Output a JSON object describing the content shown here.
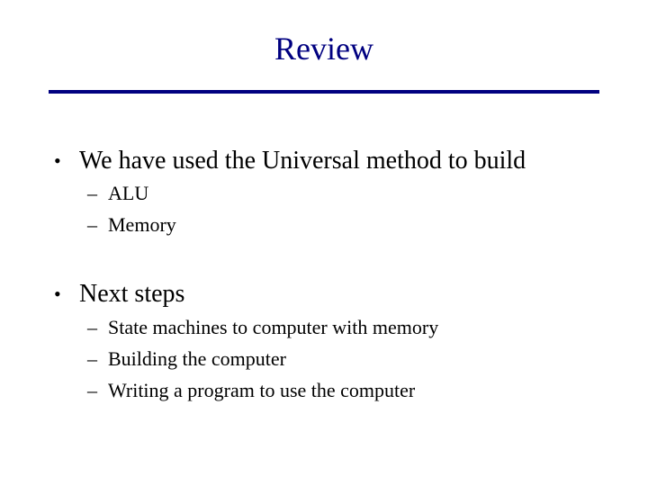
{
  "slide": {
    "title": "Review",
    "title_color": "#000080",
    "bullets": [
      {
        "marker": "•",
        "text": "We have used the Universal method to build",
        "subitems": [
          {
            "marker": "–",
            "text": "ALU"
          },
          {
            "marker": "–",
            "text": "Memory"
          }
        ]
      },
      {
        "marker": "•",
        "text": "Next steps",
        "subitems": [
          {
            "marker": "–",
            "text": "State machines to computer with memory"
          },
          {
            "marker": "–",
            "text": "Building the computer"
          },
          {
            "marker": "–",
            "text": "Writing a program to use the computer"
          }
        ]
      }
    ]
  }
}
